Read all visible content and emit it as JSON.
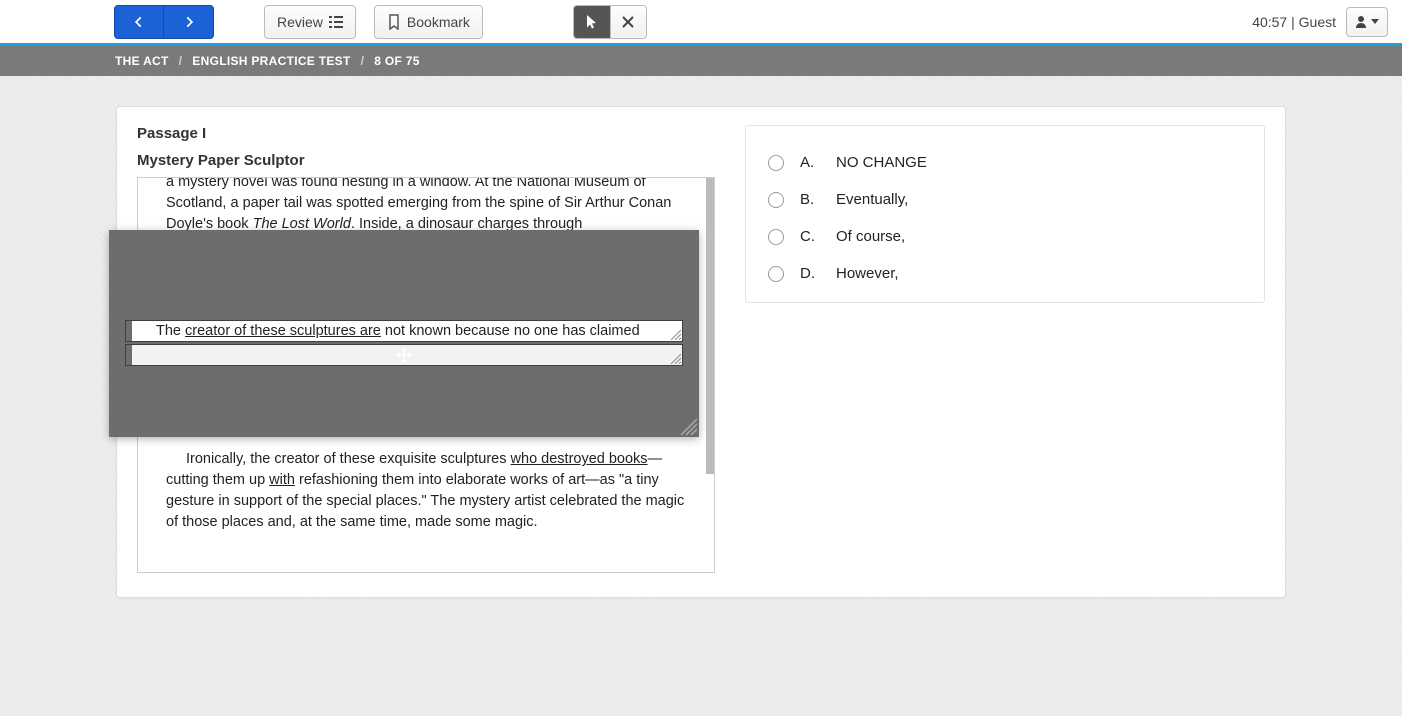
{
  "toolbar": {
    "review_label": "Review",
    "bookmark_label": "Bookmark",
    "timer_text": "40:57 | Guest"
  },
  "breadcrumb": {
    "root": "THE ACT",
    "section": "ENGLISH PRACTICE TEST",
    "progress": "8 OF 75"
  },
  "passage": {
    "label": "Passage I",
    "title": "Mystery Paper Sculptor",
    "top_fragment": "a mystery novel was found nesting in a window. At the National Museum of Scotland, a paper tail was spotted emerging from the spine of Sir Arthur Conan Doyle's book ",
    "top_italic": "The Lost World",
    "top_tail": ". Inside, a dinosaur charges through",
    "window_line_pre": "The ",
    "window_line_ul": "creator of these sculptures are",
    "window_line_post": " not known because no one has claimed",
    "bottom_pre": "Ironically, the creator of these exquisite sculptures ",
    "bottom_ul1": "who destroyed books",
    "bottom_mid": "—cutting them up ",
    "bottom_ul2": "with",
    "bottom_tail": " refashioning them into elaborate works of art—as \"a tiny gesture in support of the special places.\" The mystery artist celebrated the magic of those places and, at the same time, made some magic."
  },
  "choices": [
    {
      "letter": "A.",
      "text": "NO CHANGE"
    },
    {
      "letter": "B.",
      "text": "Eventually,"
    },
    {
      "letter": "C.",
      "text": "Of course,"
    },
    {
      "letter": "D.",
      "text": "However,"
    }
  ]
}
